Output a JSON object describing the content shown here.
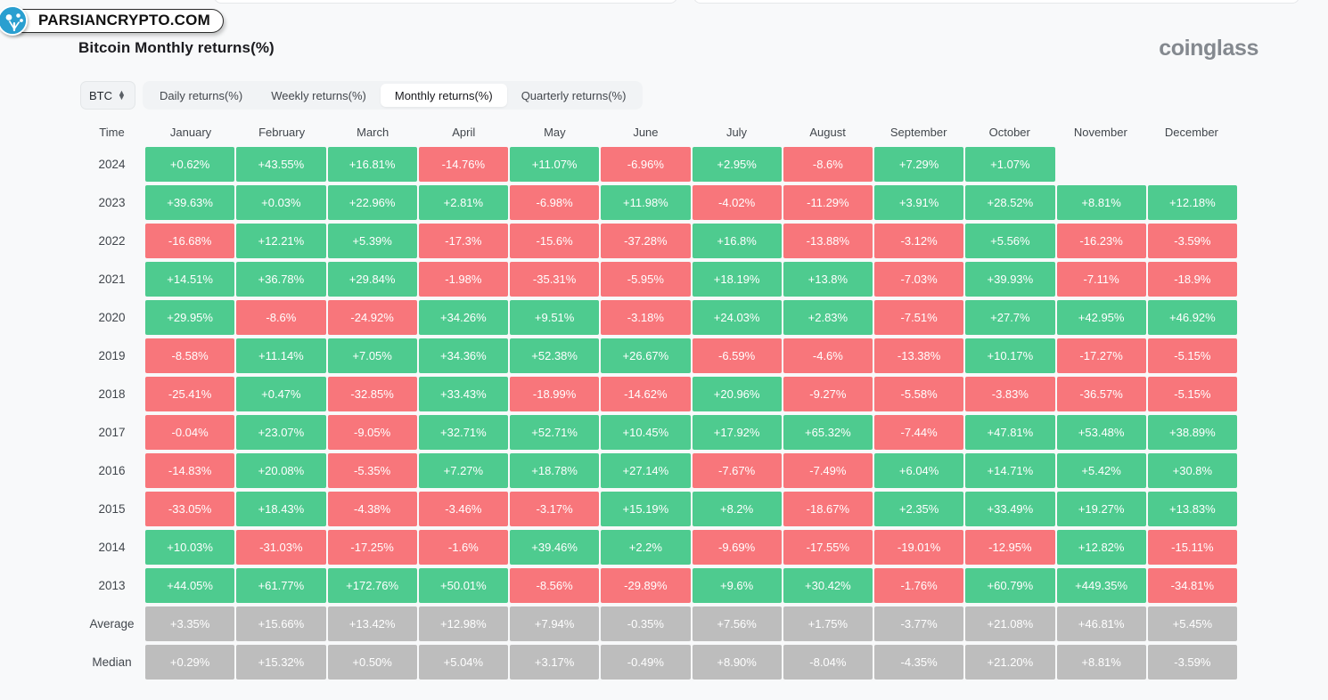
{
  "watermark": {
    "text": "PARSIANCRYPTO.COM",
    "logo_icon": "parsiancrypto-logo-icon"
  },
  "header": {
    "title": "Bitcoin Monthly returns(%)",
    "brand": "coinglass"
  },
  "controls": {
    "symbol": "BTC",
    "symbol_stepper_icon": "chevron-up-down-icon",
    "tabs": [
      {
        "label": "Daily returns(%)",
        "active": false
      },
      {
        "label": "Weekly returns(%)",
        "active": false
      },
      {
        "label": "Monthly returns(%)",
        "active": true
      },
      {
        "label": "Quarterly returns(%)",
        "active": false
      }
    ]
  },
  "colors": {
    "positive": "#4ecb8f",
    "negative": "#f8767b",
    "neutral": "#bdbdbd",
    "background": "#f8f9fa",
    "text": "#41464c"
  },
  "chart_data": {
    "type": "heatmap",
    "title": "Bitcoin Monthly returns(%)",
    "xlabel": "",
    "ylabel": "Time",
    "legend": "green = positive return, red = negative return, grey = summary row",
    "columns": [
      "Time",
      "January",
      "February",
      "March",
      "April",
      "May",
      "June",
      "July",
      "August",
      "September",
      "October",
      "November",
      "December"
    ],
    "categories": [
      "January",
      "February",
      "March",
      "April",
      "May",
      "June",
      "July",
      "August",
      "September",
      "October",
      "November",
      "December"
    ],
    "rows": [
      {
        "label": "2024",
        "values": [
          "+0.62%",
          "+43.55%",
          "+16.81%",
          "-14.76%",
          "+11.07%",
          "-6.96%",
          "+2.95%",
          "-8.6%",
          "+7.29%",
          "+1.07%",
          "",
          ""
        ]
      },
      {
        "label": "2023",
        "values": [
          "+39.63%",
          "+0.03%",
          "+22.96%",
          "+2.81%",
          "-6.98%",
          "+11.98%",
          "-4.02%",
          "-11.29%",
          "+3.91%",
          "+28.52%",
          "+8.81%",
          "+12.18%"
        ]
      },
      {
        "label": "2022",
        "values": [
          "-16.68%",
          "+12.21%",
          "+5.39%",
          "-17.3%",
          "-15.6%",
          "-37.28%",
          "+16.8%",
          "-13.88%",
          "-3.12%",
          "+5.56%",
          "-16.23%",
          "-3.59%"
        ]
      },
      {
        "label": "2021",
        "values": [
          "+14.51%",
          "+36.78%",
          "+29.84%",
          "-1.98%",
          "-35.31%",
          "-5.95%",
          "+18.19%",
          "+13.8%",
          "-7.03%",
          "+39.93%",
          "-7.11%",
          "-18.9%"
        ]
      },
      {
        "label": "2020",
        "values": [
          "+29.95%",
          "-8.6%",
          "-24.92%",
          "+34.26%",
          "+9.51%",
          "-3.18%",
          "+24.03%",
          "+2.83%",
          "-7.51%",
          "+27.7%",
          "+42.95%",
          "+46.92%"
        ]
      },
      {
        "label": "2019",
        "values": [
          "-8.58%",
          "+11.14%",
          "+7.05%",
          "+34.36%",
          "+52.38%",
          "+26.67%",
          "-6.59%",
          "-4.6%",
          "-13.38%",
          "+10.17%",
          "-17.27%",
          "-5.15%"
        ]
      },
      {
        "label": "2018",
        "values": [
          "-25.41%",
          "+0.47%",
          "-32.85%",
          "+33.43%",
          "-18.99%",
          "-14.62%",
          "+20.96%",
          "-9.27%",
          "-5.58%",
          "-3.83%",
          "-36.57%",
          "-5.15%"
        ]
      },
      {
        "label": "2017",
        "values": [
          "-0.04%",
          "+23.07%",
          "-9.05%",
          "+32.71%",
          "+52.71%",
          "+10.45%",
          "+17.92%",
          "+65.32%",
          "-7.44%",
          "+47.81%",
          "+53.48%",
          "+38.89%"
        ]
      },
      {
        "label": "2016",
        "values": [
          "-14.83%",
          "+20.08%",
          "-5.35%",
          "+7.27%",
          "+18.78%",
          "+27.14%",
          "-7.67%",
          "-7.49%",
          "+6.04%",
          "+14.71%",
          "+5.42%",
          "+30.8%"
        ]
      },
      {
        "label": "2015",
        "values": [
          "-33.05%",
          "+18.43%",
          "-4.38%",
          "-3.46%",
          "-3.17%",
          "+15.19%",
          "+8.2%",
          "-18.67%",
          "+2.35%",
          "+33.49%",
          "+19.27%",
          "+13.83%"
        ]
      },
      {
        "label": "2014",
        "values": [
          "+10.03%",
          "-31.03%",
          "-17.25%",
          "-1.6%",
          "+39.46%",
          "+2.2%",
          "-9.69%",
          "-17.55%",
          "-19.01%",
          "-12.95%",
          "+12.82%",
          "-15.11%"
        ]
      },
      {
        "label": "2013",
        "values": [
          "+44.05%",
          "+61.77%",
          "+172.76%",
          "+50.01%",
          "-8.56%",
          "-29.89%",
          "+9.6%",
          "+30.42%",
          "-1.76%",
          "+60.79%",
          "+449.35%",
          "-34.81%"
        ]
      },
      {
        "label": "Average",
        "summary": true,
        "values": [
          "+3.35%",
          "+15.66%",
          "+13.42%",
          "+12.98%",
          "+7.94%",
          "-0.35%",
          "+7.56%",
          "+1.75%",
          "-3.77%",
          "+21.08%",
          "+46.81%",
          "+5.45%"
        ]
      },
      {
        "label": "Median",
        "summary": true,
        "values": [
          "+0.29%",
          "+15.32%",
          "+0.50%",
          "+5.04%",
          "+3.17%",
          "-0.49%",
          "+8.90%",
          "-8.04%",
          "-4.35%",
          "+21.20%",
          "+8.81%",
          "-3.59%"
        ]
      }
    ]
  }
}
